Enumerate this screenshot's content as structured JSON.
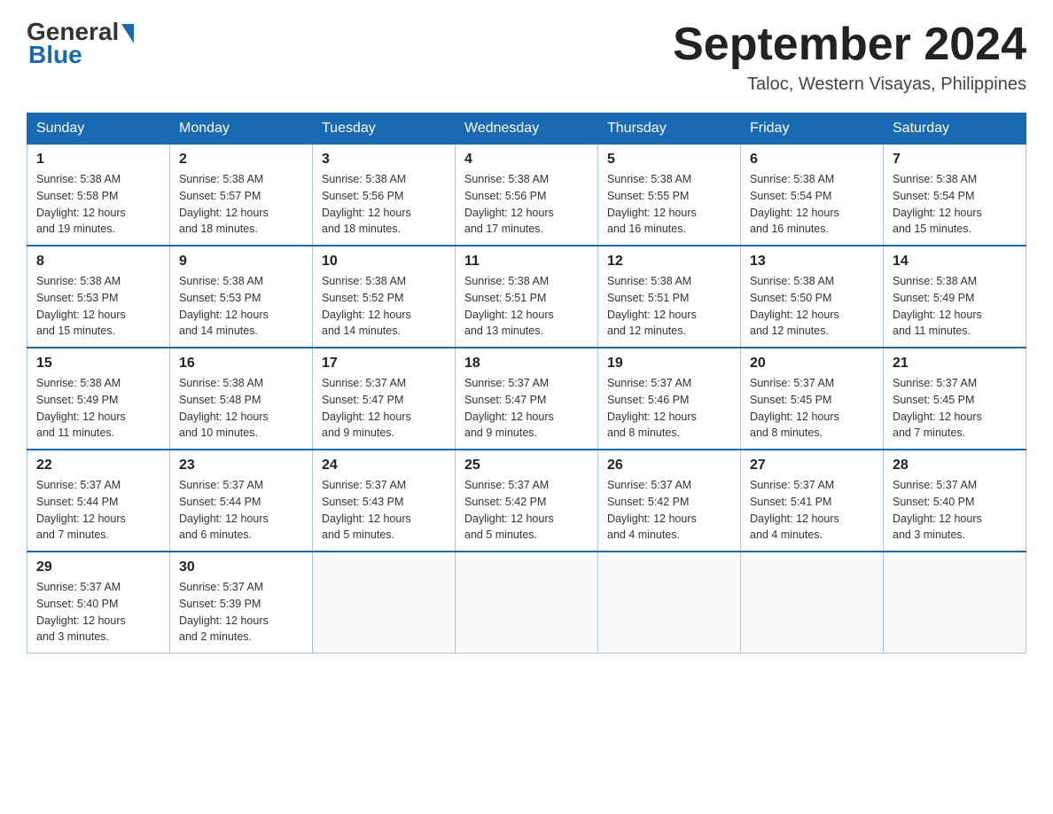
{
  "header": {
    "logo_general": "General",
    "logo_blue": "Blue",
    "month_title": "September 2024",
    "location": "Taloc, Western Visayas, Philippines"
  },
  "days_of_week": [
    "Sunday",
    "Monday",
    "Tuesday",
    "Wednesday",
    "Thursday",
    "Friday",
    "Saturday"
  ],
  "weeks": [
    [
      {
        "day": "1",
        "sunrise": "5:38 AM",
        "sunset": "5:58 PM",
        "daylight": "12 hours and 19 minutes."
      },
      {
        "day": "2",
        "sunrise": "5:38 AM",
        "sunset": "5:57 PM",
        "daylight": "12 hours and 18 minutes."
      },
      {
        "day": "3",
        "sunrise": "5:38 AM",
        "sunset": "5:56 PM",
        "daylight": "12 hours and 18 minutes."
      },
      {
        "day": "4",
        "sunrise": "5:38 AM",
        "sunset": "5:56 PM",
        "daylight": "12 hours and 17 minutes."
      },
      {
        "day": "5",
        "sunrise": "5:38 AM",
        "sunset": "5:55 PM",
        "daylight": "12 hours and 16 minutes."
      },
      {
        "day": "6",
        "sunrise": "5:38 AM",
        "sunset": "5:54 PM",
        "daylight": "12 hours and 16 minutes."
      },
      {
        "day": "7",
        "sunrise": "5:38 AM",
        "sunset": "5:54 PM",
        "daylight": "12 hours and 15 minutes."
      }
    ],
    [
      {
        "day": "8",
        "sunrise": "5:38 AM",
        "sunset": "5:53 PM",
        "daylight": "12 hours and 15 minutes."
      },
      {
        "day": "9",
        "sunrise": "5:38 AM",
        "sunset": "5:53 PM",
        "daylight": "12 hours and 14 minutes."
      },
      {
        "day": "10",
        "sunrise": "5:38 AM",
        "sunset": "5:52 PM",
        "daylight": "12 hours and 14 minutes."
      },
      {
        "day": "11",
        "sunrise": "5:38 AM",
        "sunset": "5:51 PM",
        "daylight": "12 hours and 13 minutes."
      },
      {
        "day": "12",
        "sunrise": "5:38 AM",
        "sunset": "5:51 PM",
        "daylight": "12 hours and 12 minutes."
      },
      {
        "day": "13",
        "sunrise": "5:38 AM",
        "sunset": "5:50 PM",
        "daylight": "12 hours and 12 minutes."
      },
      {
        "day": "14",
        "sunrise": "5:38 AM",
        "sunset": "5:49 PM",
        "daylight": "12 hours and 11 minutes."
      }
    ],
    [
      {
        "day": "15",
        "sunrise": "5:38 AM",
        "sunset": "5:49 PM",
        "daylight": "12 hours and 11 minutes."
      },
      {
        "day": "16",
        "sunrise": "5:38 AM",
        "sunset": "5:48 PM",
        "daylight": "12 hours and 10 minutes."
      },
      {
        "day": "17",
        "sunrise": "5:37 AM",
        "sunset": "5:47 PM",
        "daylight": "12 hours and 9 minutes."
      },
      {
        "day": "18",
        "sunrise": "5:37 AM",
        "sunset": "5:47 PM",
        "daylight": "12 hours and 9 minutes."
      },
      {
        "day": "19",
        "sunrise": "5:37 AM",
        "sunset": "5:46 PM",
        "daylight": "12 hours and 8 minutes."
      },
      {
        "day": "20",
        "sunrise": "5:37 AM",
        "sunset": "5:45 PM",
        "daylight": "12 hours and 8 minutes."
      },
      {
        "day": "21",
        "sunrise": "5:37 AM",
        "sunset": "5:45 PM",
        "daylight": "12 hours and 7 minutes."
      }
    ],
    [
      {
        "day": "22",
        "sunrise": "5:37 AM",
        "sunset": "5:44 PM",
        "daylight": "12 hours and 7 minutes."
      },
      {
        "day": "23",
        "sunrise": "5:37 AM",
        "sunset": "5:44 PM",
        "daylight": "12 hours and 6 minutes."
      },
      {
        "day": "24",
        "sunrise": "5:37 AM",
        "sunset": "5:43 PM",
        "daylight": "12 hours and 5 minutes."
      },
      {
        "day": "25",
        "sunrise": "5:37 AM",
        "sunset": "5:42 PM",
        "daylight": "12 hours and 5 minutes."
      },
      {
        "day": "26",
        "sunrise": "5:37 AM",
        "sunset": "5:42 PM",
        "daylight": "12 hours and 4 minutes."
      },
      {
        "day": "27",
        "sunrise": "5:37 AM",
        "sunset": "5:41 PM",
        "daylight": "12 hours and 4 minutes."
      },
      {
        "day": "28",
        "sunrise": "5:37 AM",
        "sunset": "5:40 PM",
        "daylight": "12 hours and 3 minutes."
      }
    ],
    [
      {
        "day": "29",
        "sunrise": "5:37 AM",
        "sunset": "5:40 PM",
        "daylight": "12 hours and 3 minutes."
      },
      {
        "day": "30",
        "sunrise": "5:37 AM",
        "sunset": "5:39 PM",
        "daylight": "12 hours and 2 minutes."
      },
      null,
      null,
      null,
      null,
      null
    ]
  ],
  "labels": {
    "sunrise_prefix": "Sunrise: ",
    "sunset_prefix": "Sunset: ",
    "daylight_prefix": "Daylight: "
  }
}
